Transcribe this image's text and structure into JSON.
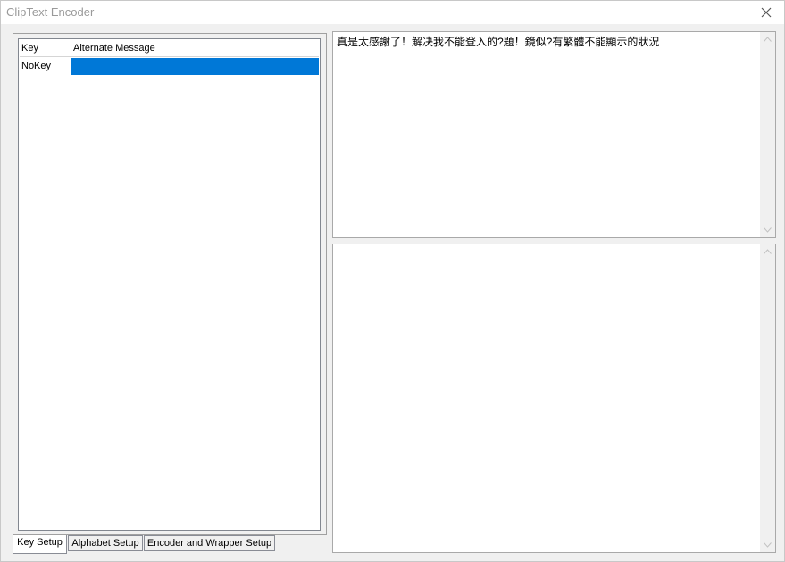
{
  "window": {
    "title": "ClipText Encoder",
    "close_icon": "close-icon"
  },
  "key_list": {
    "columns": [
      "Key",
      "Alternate Message"
    ],
    "rows": [
      {
        "key": "NoKey",
        "alternate_message": ""
      }
    ]
  },
  "tabs": [
    {
      "label": "Key Setup",
      "active": true
    },
    {
      "label": "Alphabet Setup",
      "active": false
    },
    {
      "label": "Encoder and Wrapper Setup",
      "active": false
    }
  ],
  "input_text": "真是太感謝了！解决我不能登入的?題！鏡似?有繁體不能顯示的狀況",
  "output_text": "",
  "colors": {
    "selection": "#0078d7",
    "window_bg": "#f0f0f0"
  }
}
